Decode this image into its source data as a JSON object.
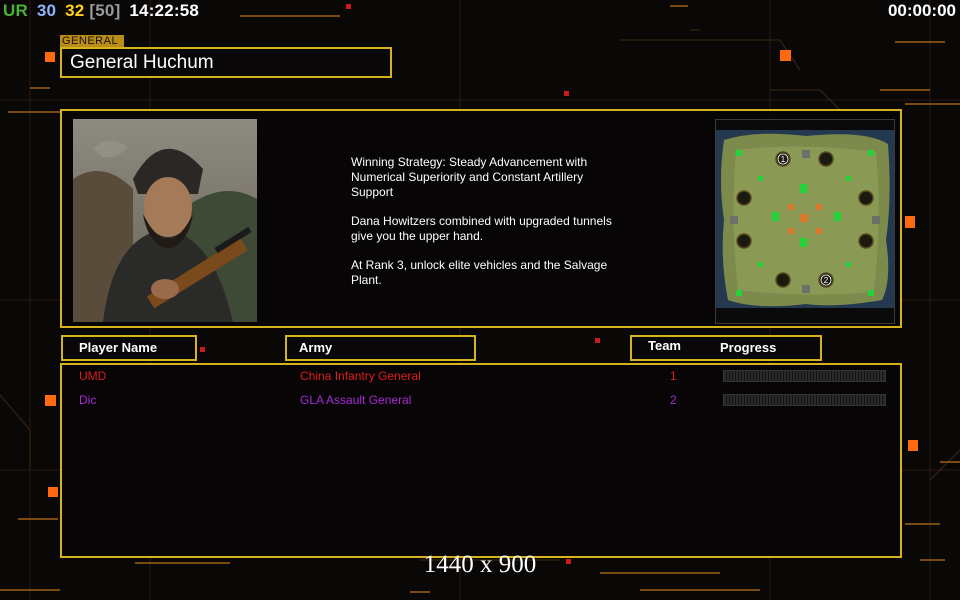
{
  "hud": {
    "left": [
      {
        "text": "UR",
        "color": "#4ab13a"
      },
      {
        "text": "30",
        "color": "#8fb7ff"
      },
      {
        "text": "32",
        "color": "#ffd21e"
      },
      {
        "text": "[50]",
        "color": "#9a9a9a"
      },
      {
        "text": "14:22:58",
        "color": "#ffffff"
      }
    ],
    "right": "00:00:00"
  },
  "general": {
    "tag": "GENERAL",
    "name": "General Huchum"
  },
  "strategy": [
    "Winning Strategy: Steady Advancement with\n Numerical Superiority and Constant Artillery\n Support",
    "Dana Howitzers combined with upgraded tunnels\n give you the upper hand.",
    "At Rank 3, unlock elite vehicles and the Salvage\n Plant."
  ],
  "map": {
    "start_1": "1",
    "start_2": "2"
  },
  "table": {
    "player_header": "Player Name",
    "army_header": "Army",
    "team_header": "Team",
    "progress_header": "Progress",
    "rows": [
      {
        "name": "UMD",
        "army": "China Infantry General",
        "team": "1",
        "color": "#e11c1c"
      },
      {
        "name": "Dic",
        "army": "GLA Assault General",
        "team": "2",
        "color": "#a62bd6"
      }
    ]
  },
  "resolution": "1440 x 900",
  "colors": {
    "frame": "#d6b21c",
    "accent_orange": "#ff7a12"
  }
}
